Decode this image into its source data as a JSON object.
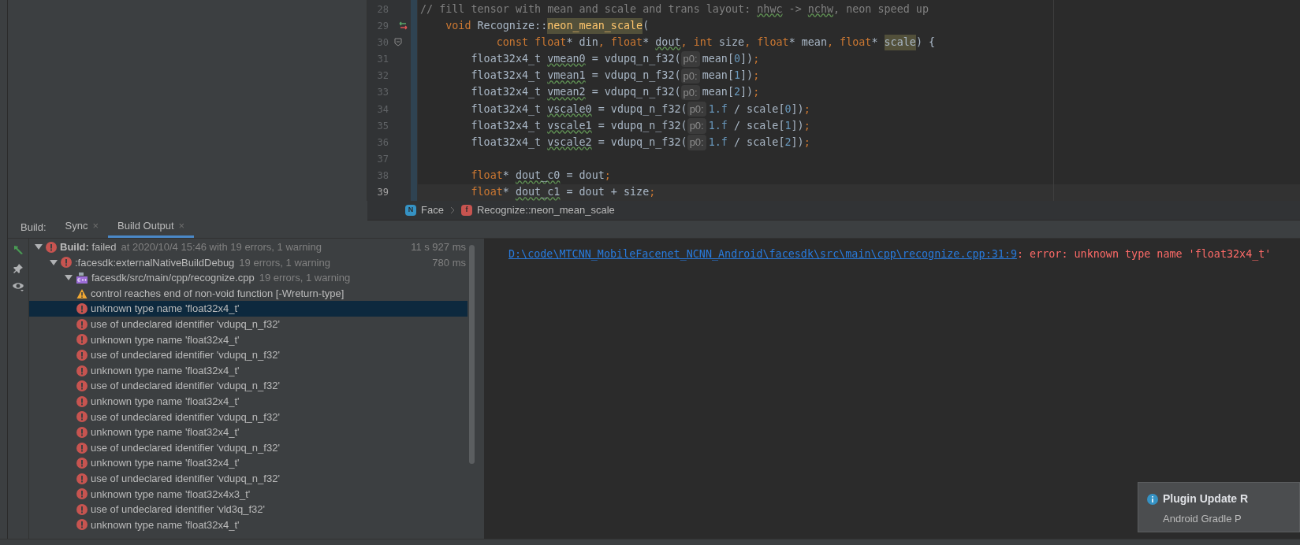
{
  "editor": {
    "lines": [
      {
        "number": "28",
        "current": false,
        "segments": [
          {
            "text": "// fill tensor with mean and scale and trans layout: ",
            "kind": "comment"
          },
          {
            "text": "nhwc",
            "kind": "commenttypo"
          },
          {
            "text": " -> ",
            "kind": "comment"
          },
          {
            "text": "nchw",
            "kind": "commenttypo"
          },
          {
            "text": ", neon speed up",
            "kind": "comment"
          }
        ]
      },
      {
        "number": "29",
        "current": false,
        "gutter_icons": [
          {
            "kind": "override"
          }
        ],
        "segments": [
          {
            "text": "    void",
            "kind": "keyword"
          },
          {
            "text": " Recognize::",
            "kind": "plain"
          },
          {
            "text": "neon_mean_scale",
            "kind": "declaration"
          },
          {
            "text": "(",
            "kind": "plain"
          }
        ]
      },
      {
        "number": "30",
        "current": false,
        "gutter_icons": [
          {
            "kind": "fold"
          }
        ],
        "segments": [
          {
            "text": "            const float",
            "kind": "keyword"
          },
          {
            "text": "* din",
            "kind": "plain"
          },
          {
            "text": ", float",
            "kind": "keyword"
          },
          {
            "text": "* ",
            "kind": "plain"
          },
          {
            "text": "dout",
            "kind": "typo"
          },
          {
            "text": ", int",
            "kind": "keyword"
          },
          {
            "text": " size",
            "kind": "plain"
          },
          {
            "text": ", float",
            "kind": "keyword"
          },
          {
            "text": "* mean",
            "kind": "plain"
          },
          {
            "text": ", float",
            "kind": "keyword"
          },
          {
            "text": "* ",
            "kind": "plain"
          },
          {
            "text": "scale",
            "kind": "usage"
          },
          {
            "text": ") {",
            "kind": "plain"
          }
        ]
      },
      {
        "number": "31",
        "current": false,
        "segments": [
          {
            "text": "        float32x4_t ",
            "kind": "plain"
          },
          {
            "text": "vmean0",
            "kind": "typo"
          },
          {
            "text": " = vdupq_n_f32(",
            "kind": "plain"
          },
          {
            "text": "p0:",
            "kind": "hint"
          },
          {
            "text": "mean[",
            "kind": "plain"
          },
          {
            "text": "0",
            "kind": "number"
          },
          {
            "text": "])",
            "kind": "plain"
          },
          {
            "text": ";",
            "kind": "keyword"
          }
        ]
      },
      {
        "number": "32",
        "current": false,
        "segments": [
          {
            "text": "        float32x4_t ",
            "kind": "plain"
          },
          {
            "text": "vmean1",
            "kind": "typo"
          },
          {
            "text": " = vdupq_n_f32(",
            "kind": "plain"
          },
          {
            "text": "p0:",
            "kind": "hint"
          },
          {
            "text": "mean[",
            "kind": "plain"
          },
          {
            "text": "1",
            "kind": "number"
          },
          {
            "text": "])",
            "kind": "plain"
          },
          {
            "text": ";",
            "kind": "keyword"
          }
        ]
      },
      {
        "number": "33",
        "current": false,
        "segments": [
          {
            "text": "        float32x4_t ",
            "kind": "plain"
          },
          {
            "text": "vmean2",
            "kind": "typo"
          },
          {
            "text": " = vdupq_n_f32(",
            "kind": "plain"
          },
          {
            "text": "p0:",
            "kind": "hint"
          },
          {
            "text": "mean[",
            "kind": "plain"
          },
          {
            "text": "2",
            "kind": "number"
          },
          {
            "text": "])",
            "kind": "plain"
          },
          {
            "text": ";",
            "kind": "keyword"
          }
        ]
      },
      {
        "number": "34",
        "current": false,
        "segments": [
          {
            "text": "        float32x4_t ",
            "kind": "plain"
          },
          {
            "text": "vscale0",
            "kind": "typo"
          },
          {
            "text": " = vdupq_n_f32(",
            "kind": "plain"
          },
          {
            "text": "p0:",
            "kind": "hint"
          },
          {
            "text": "1.f",
            "kind": "number"
          },
          {
            "text": " / scale[",
            "kind": "plain"
          },
          {
            "text": "0",
            "kind": "number"
          },
          {
            "text": "])",
            "kind": "plain"
          },
          {
            "text": ";",
            "kind": "keyword"
          }
        ]
      },
      {
        "number": "35",
        "current": false,
        "segments": [
          {
            "text": "        float32x4_t ",
            "kind": "plain"
          },
          {
            "text": "vscale1",
            "kind": "typo"
          },
          {
            "text": " = vdupq_n_f32(",
            "kind": "plain"
          },
          {
            "text": "p0:",
            "kind": "hint"
          },
          {
            "text": "1.f",
            "kind": "number"
          },
          {
            "text": " / scale[",
            "kind": "plain"
          },
          {
            "text": "1",
            "kind": "number"
          },
          {
            "text": "])",
            "kind": "plain"
          },
          {
            "text": ";",
            "kind": "keyword"
          }
        ]
      },
      {
        "number": "36",
        "current": false,
        "segments": [
          {
            "text": "        float32x4_t ",
            "kind": "plain"
          },
          {
            "text": "vscale2",
            "kind": "typo"
          },
          {
            "text": " = vdupq_n_f32(",
            "kind": "plain"
          },
          {
            "text": "p0:",
            "kind": "hint"
          },
          {
            "text": "1.f",
            "kind": "number"
          },
          {
            "text": " / scale[",
            "kind": "plain"
          },
          {
            "text": "2",
            "kind": "number"
          },
          {
            "text": "])",
            "kind": "plain"
          },
          {
            "text": ";",
            "kind": "keyword"
          }
        ]
      },
      {
        "number": "37",
        "current": false
      },
      {
        "number": "38",
        "current": false,
        "segments": [
          {
            "text": "        float",
            "kind": "keyword"
          },
          {
            "text": "* ",
            "kind": "plain"
          },
          {
            "text": "dout_c0",
            "kind": "typo"
          },
          {
            "text": " = dout",
            "kind": "plain"
          },
          {
            "text": ";",
            "kind": "keyword"
          }
        ]
      },
      {
        "number": "39",
        "current": true,
        "segments": [
          {
            "text": "        float",
            "kind": "keyword"
          },
          {
            "text": "* ",
            "kind": "plain"
          },
          {
            "text": "dout_c1",
            "kind": "typo"
          },
          {
            "text": " = dout + size",
            "kind": "plain"
          },
          {
            "text": ";",
            "kind": "keyword"
          }
        ]
      }
    ]
  },
  "breadcrumbs": [
    {
      "kind": "namespace",
      "badge": "N",
      "label": "Face"
    },
    {
      "kind": "function",
      "badge": "f",
      "label": "Recognize::neon_mean_scale"
    }
  ],
  "tool_window": {
    "label": "Build:",
    "tabs": [
      {
        "label": "Sync",
        "close": "×",
        "selected": false
      },
      {
        "label": "Build Output",
        "close": "×",
        "selected": true
      }
    ]
  },
  "build_tree": [
    {
      "kind": "error",
      "label": "**Build:** failed",
      "detail": "at 2020/10/4 15:46 with 19 errors, 1 warning",
      "time": "11 s 927 ms",
      "expanded": true,
      "selected": false,
      "children": [
        {
          "kind": "error",
          "label": ":facesdk:externalNativeBuildDebug",
          "detail": "19 errors, 1 warning",
          "time": "780 ms",
          "expanded": true,
          "selected": false,
          "children": [
            {
              "kind": "cpp-file",
              "label": "facesdk/src/main/cpp/recognize.cpp",
              "detail": "19 errors, 1 warning",
              "expanded": true,
              "selected": false,
              "children": [
                {
                  "kind": "warning",
                  "label": "control reaches end of non-void function [-Wreturn-type]",
                  "selected": false
                },
                {
                  "kind": "error",
                  "label": "unknown type name 'float32x4_t'",
                  "selected": true
                },
                {
                  "kind": "error",
                  "label": "use of undeclared identifier 'vdupq_n_f32'",
                  "selected": false
                },
                {
                  "kind": "error",
                  "label": "unknown type name 'float32x4_t'",
                  "selected": false
                },
                {
                  "kind": "error",
                  "label": "use of undeclared identifier 'vdupq_n_f32'",
                  "selected": false
                },
                {
                  "kind": "error",
                  "label": "unknown type name 'float32x4_t'",
                  "selected": false
                },
                {
                  "kind": "error",
                  "label": "use of undeclared identifier 'vdupq_n_f32'",
                  "selected": false
                },
                {
                  "kind": "error",
                  "label": "unknown type name 'float32x4_t'",
                  "selected": false
                },
                {
                  "kind": "error",
                  "label": "use of undeclared identifier 'vdupq_n_f32'",
                  "selected": false
                },
                {
                  "kind": "error",
                  "label": "unknown type name 'float32x4_t'",
                  "selected": false
                },
                {
                  "kind": "error",
                  "label": "use of undeclared identifier 'vdupq_n_f32'",
                  "selected": false
                },
                {
                  "kind": "error",
                  "label": "unknown type name 'float32x4_t'",
                  "selected": false
                },
                {
                  "kind": "error",
                  "label": "use of undeclared identifier 'vdupq_n_f32'",
                  "selected": false
                },
                {
                  "kind": "error",
                  "label": "unknown type name 'float32x4x3_t'",
                  "selected": false
                },
                {
                  "kind": "error",
                  "label": "use of undeclared identifier 'vld3q_f32'",
                  "selected": false
                },
                {
                  "kind": "error",
                  "label": "unknown type name 'float32x4_t'",
                  "selected": false
                }
              ]
            }
          ]
        }
      ]
    }
  ],
  "console": {
    "link": "D:\\code\\MTCNN_MobileFacenet_NCNN_Android\\facesdk\\src\\main\\cpp\\recognize.cpp:31:9",
    "message": ": error: unknown type name 'float32x4_t'"
  },
  "notification": {
    "title": "Plugin Update R",
    "body": "Android Gradle P"
  }
}
